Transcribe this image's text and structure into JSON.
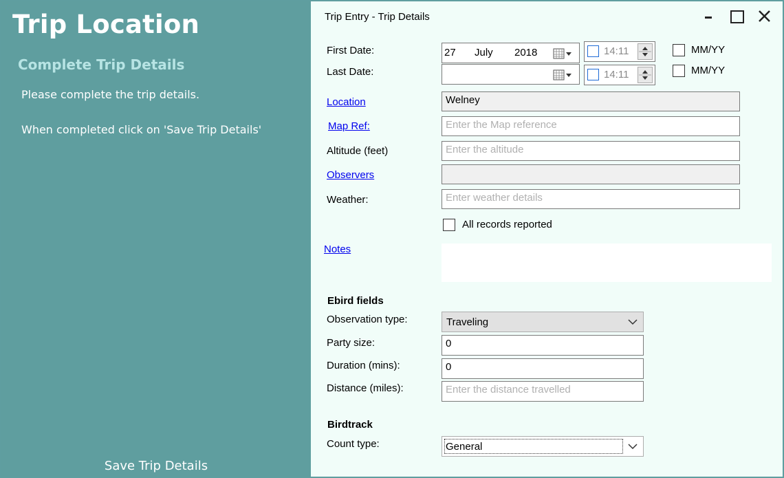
{
  "sidebar": {
    "title": "Trip Location",
    "subtitle": "Complete Trip Details",
    "instruction1": "Please complete the trip details.",
    "instruction2": "When completed click on 'Save Trip Details'",
    "save_label": "Save Trip Details"
  },
  "window": {
    "title": "Trip Entry - Trip Details"
  },
  "form": {
    "first_date_label": "First Date:",
    "last_date_label": "Last Date:",
    "first_date": {
      "day": "27",
      "month": "July",
      "year": "2018"
    },
    "last_date": {
      "day": "",
      "month": "",
      "year": ""
    },
    "first_time": "14:11",
    "last_time": "14:11",
    "mmyy_label_1": "MM/YY",
    "mmyy_label_2": "MM/YY",
    "location_label": "Location",
    "location_value": "Welney",
    "mapref_label": "Map Ref:",
    "mapref_placeholder": "Enter the Map reference",
    "altitude_label": "Altitude (feet)",
    "altitude_placeholder": "Enter the altitude",
    "observers_label": "Observers",
    "observers_value": "",
    "weather_label": "Weather:",
    "weather_placeholder": "Enter weather details",
    "all_records_label": "All records reported",
    "notes_label": "Notes",
    "notes_value": ""
  },
  "ebird": {
    "heading": "Ebird fields",
    "obs_type_label": "Observation type:",
    "obs_type_value": "Traveling",
    "party_size_label": "Party size:",
    "party_size_value": "0",
    "duration_label": "Duration (mins):",
    "duration_value": "0",
    "distance_label": "Distance (miles):",
    "distance_placeholder": "Enter the distance travelled"
  },
  "birdtrack": {
    "heading": "Birdtrack",
    "count_type_label": "Count type:",
    "count_type_value": "General"
  },
  "colors": {
    "sidebar_bg": "#5f9e9f",
    "subtitle": "#b7e4e4",
    "panel_bg": "#f1fdf9",
    "link": "#0000ee"
  }
}
